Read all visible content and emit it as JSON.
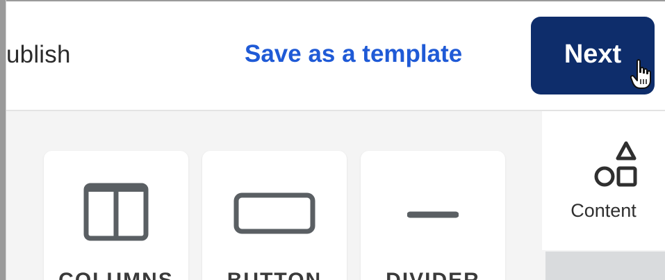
{
  "header": {
    "publish_label": "ublish",
    "save_template_label": "Save as a template",
    "next_label": "Next"
  },
  "blocks": [
    {
      "label": "COLUMNS",
      "icon": "columns-icon"
    },
    {
      "label": "BUTTON",
      "icon": "button-block-icon"
    },
    {
      "label": "DIVIDER",
      "icon": "divider-icon"
    }
  ],
  "sidebar": {
    "content_label": "Content",
    "content_icon": "shapes-icon"
  },
  "colors": {
    "next_bg": "#0e2d6b",
    "link": "#1f5ad6",
    "icon": "#5a5f63"
  }
}
